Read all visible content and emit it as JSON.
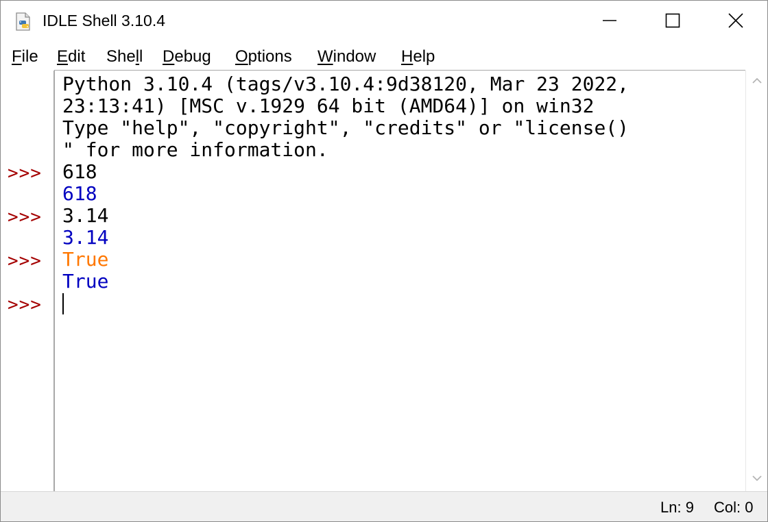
{
  "window": {
    "title": "IDLE Shell 3.10.4"
  },
  "menu": {
    "items": [
      {
        "label_ul": "F",
        "label_rest": "ile"
      },
      {
        "label_ul": "E",
        "label_rest": "dit"
      },
      {
        "label_pre": "She",
        "label_ul": "l",
        "label_rest": "l"
      },
      {
        "label_ul": "D",
        "label_rest": "ebug"
      },
      {
        "label_ul": "O",
        "label_rest": "ptions"
      },
      {
        "label_ul": "W",
        "label_rest": "indow"
      },
      {
        "label_ul": "H",
        "label_rest": "elp"
      }
    ]
  },
  "shell": {
    "banner": [
      "Python 3.10.4 (tags/v3.10.4:9d38120, Mar 23 2022,",
      "23:13:41) [MSC v.1929 64 bit (AMD64)] on win32",
      "Type \"help\", \"copyright\", \"credits\" or \"license()",
      "\" for more information."
    ],
    "prompt": ">>>",
    "entries": [
      {
        "input": "618",
        "output": "618"
      },
      {
        "input": "3.14",
        "output": "3.14"
      },
      {
        "input": "True",
        "output": "True"
      }
    ]
  },
  "status": {
    "ln": "Ln: 9",
    "col": "Col: 0"
  },
  "colors": {
    "prompt": "#a40000",
    "output": "#0000c0",
    "keyword": "#ff7700"
  },
  "icons": {
    "app": "python-file-icon",
    "minimize": "minimize-icon",
    "maximize": "maximize-icon",
    "close": "close-icon",
    "scroll_up": "chevron-up-icon",
    "scroll_down": "chevron-down-icon"
  }
}
